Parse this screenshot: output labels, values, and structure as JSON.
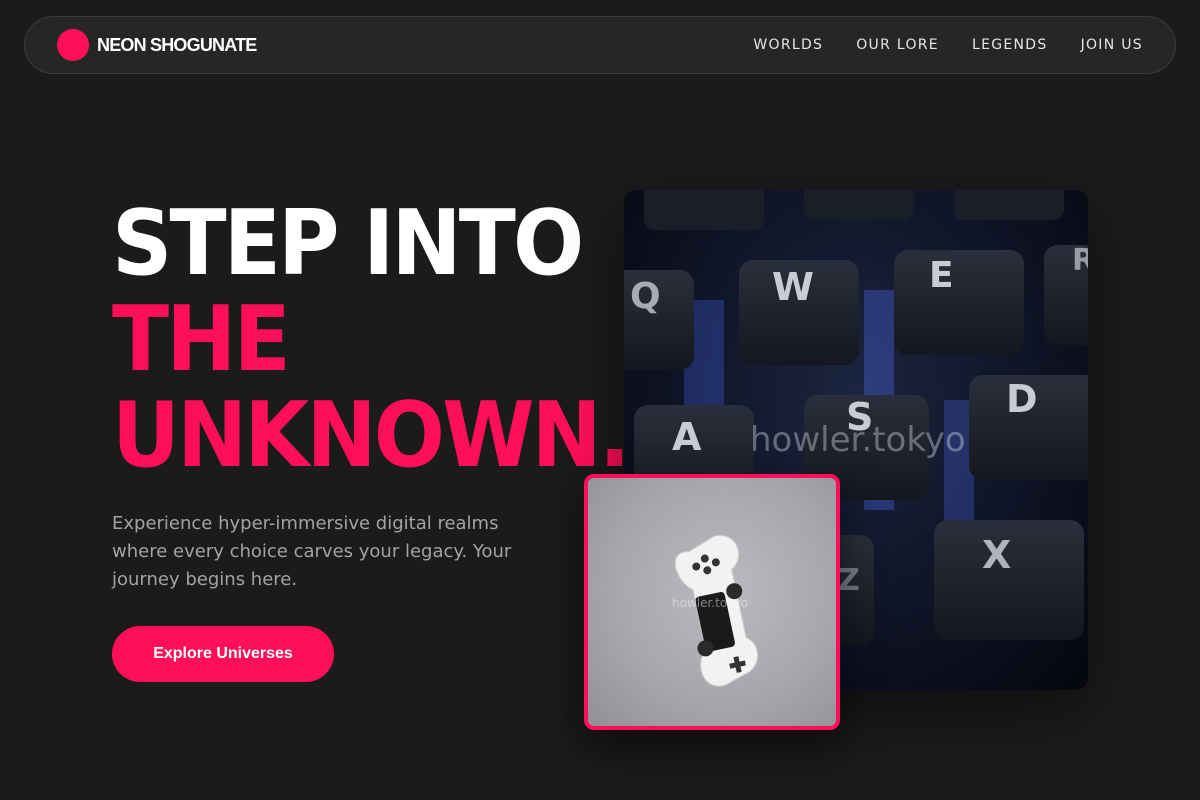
{
  "header": {
    "brand": "NEON SHOGUNATE",
    "nav": [
      "WORLDS",
      "OUR LORE",
      "LEGENDS",
      "JOIN US"
    ]
  },
  "hero": {
    "title_line1": "STEP INTO",
    "title_line2": "THE",
    "title_line3": "UNKNOWN.",
    "description": "Experience hyper-immersive digital realms where every choice carves your legacy. Your journey begins here.",
    "cta_label": "Explore Universes"
  },
  "images": {
    "keyboard": {
      "watermark": "howler.tokyo",
      "key_letters": [
        "Q",
        "W",
        "E",
        "R",
        "A",
        "S",
        "D",
        "Z",
        "X"
      ]
    },
    "controller": {
      "watermark": "howler.tokyo"
    }
  },
  "colors": {
    "accent": "#ff0f5a",
    "background": "#1b1b1b",
    "nav_bg": "#262626",
    "text_muted": "#a3a3a3"
  }
}
